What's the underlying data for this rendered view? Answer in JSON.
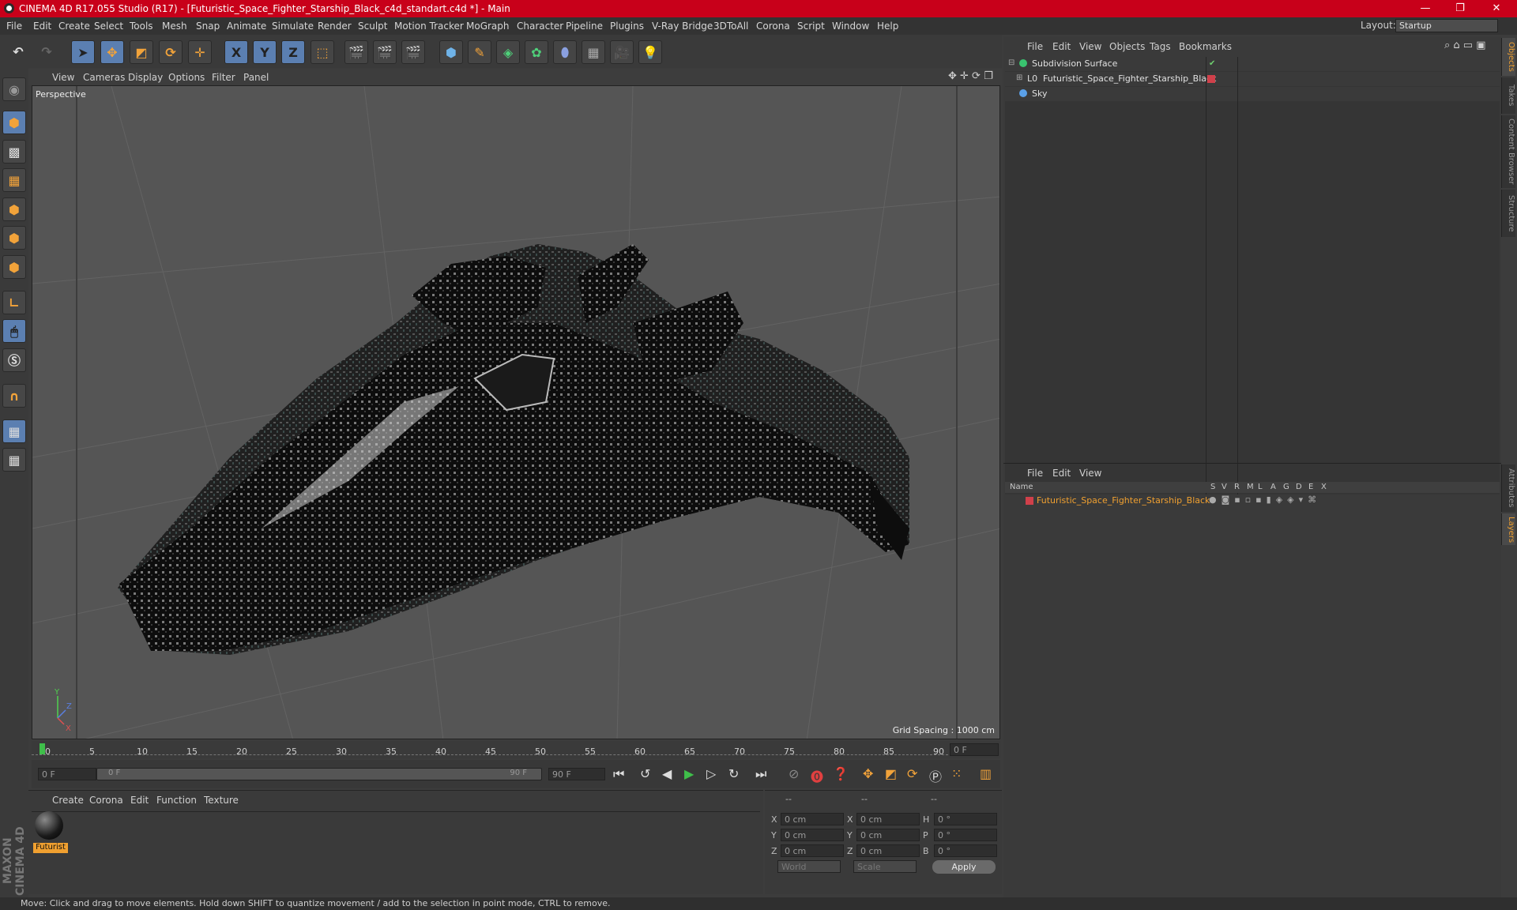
{
  "window": {
    "title": "CINEMA 4D R17.055 Studio (R17) - [Futuristic_Space_Fighter_Starship_Black_c4d_standart.c4d *] - Main",
    "controls": {
      "minimize": "—",
      "restore": "❐",
      "close": "✕"
    }
  },
  "menubar": {
    "items": [
      "File",
      "Edit",
      "Create",
      "Select",
      "Tools",
      "Mesh",
      "Snap",
      "Animate",
      "Simulate",
      "Render",
      "Sculpt",
      "Motion Tracker",
      "MoGraph",
      "Character",
      "Pipeline",
      "Plugins",
      "V-Ray Bridge",
      "3DToAll",
      "Corona",
      "Script",
      "Window",
      "Help"
    ],
    "layout_label": "Layout:",
    "layout_value": "Startup"
  },
  "toolbar": {
    "axis_x": "X",
    "axis_y": "Y",
    "axis_z": "Z"
  },
  "viewport": {
    "menu": [
      "View",
      "Cameras",
      "Display",
      "Options",
      "Filter",
      "Panel"
    ],
    "camera_label": "Perspective",
    "grid_spacing": "Grid Spacing : 1000 cm",
    "axis_labels": {
      "y": "Y",
      "z": "Z",
      "x": "X"
    }
  },
  "timeline": {
    "ticks": [
      "0",
      "5",
      "10",
      "15",
      "20",
      "25",
      "30",
      "35",
      "40",
      "45",
      "50",
      "55",
      "60",
      "65",
      "70",
      "75",
      "80",
      "85",
      "90"
    ],
    "current_frame_field": "0 F",
    "start_field": "0 F",
    "range_start": "0 F",
    "range_end": "90 F",
    "end_field": "90 F"
  },
  "object_manager": {
    "menu": [
      "File",
      "Edit",
      "View",
      "Objects",
      "Tags",
      "Bookmarks"
    ],
    "objects": [
      {
        "name": "Subdivision Surface"
      },
      {
        "name": "Futuristic_Space_Fighter_Starship_Black"
      },
      {
        "name": "Sky"
      }
    ]
  },
  "layer_manager": {
    "menu": [
      "File",
      "Edit",
      "View"
    ],
    "columns": [
      "Name",
      "S",
      "V",
      "R",
      "M",
      "L",
      "A",
      "G",
      "D",
      "E",
      "X"
    ],
    "rows": [
      {
        "name": "Futuristic_Space_Fighter_Starship_Black"
      }
    ]
  },
  "side_tabs": [
    "Objects",
    "Takes",
    "Content Browser",
    "Structure",
    "Attributes",
    "Layers"
  ],
  "material_manager": {
    "menu": [
      "Create",
      "Corona",
      "Edit",
      "Function",
      "Texture"
    ],
    "materials": [
      {
        "label": "Futurist"
      }
    ]
  },
  "coordinates": {
    "headers": [
      "--",
      "--",
      "--"
    ],
    "rows": [
      {
        "a": "X",
        "av": "0 cm",
        "b": "X",
        "bv": "0 cm",
        "c": "H",
        "cv": "0 °"
      },
      {
        "a": "Y",
        "av": "0 cm",
        "b": "Y",
        "bv": "0 cm",
        "c": "P",
        "cv": "0 °"
      },
      {
        "a": "Z",
        "av": "0 cm",
        "b": "Z",
        "bv": "0 cm",
        "c": "B",
        "cv": "0 °"
      }
    ],
    "mode1": "World",
    "mode2": "Scale",
    "apply_label": "Apply"
  },
  "branding": "MAXON CINEMA 4D",
  "status": "Move: Click and drag to move elements. Hold down SHIFT to quantize movement / add to the selection in point mode, CTRL to remove.",
  "colors": {
    "title_bar": "#c8001a",
    "accent_orange": "#f0a030",
    "selection_blue": "#5b7fb1"
  }
}
